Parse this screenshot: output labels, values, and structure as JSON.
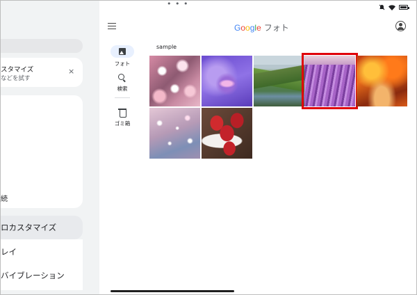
{
  "status_bar": {
    "dots": "• • •"
  },
  "left_panel": {
    "card_title": "スタマイズ",
    "card_subtitle": "などを試す",
    "card_close": "×",
    "item_text": "続",
    "selected_item": "ロカスタマイズ",
    "item_display": "レイ",
    "item_vibration": "バイブレーション"
  },
  "app_bar": {
    "logo": {
      "G": "G",
      "o1": "o",
      "o2": "o",
      "g": "g",
      "l": "l",
      "e": "e",
      "suffix": "フォト"
    }
  },
  "rail": {
    "photos_label": "フォト",
    "search_label": "検索",
    "trash_label": "ゴミ箱"
  },
  "album": {
    "title": "sample",
    "photos": [
      {
        "name": "cherry-blossom",
        "selected": false
      },
      {
        "name": "lotus",
        "selected": false
      },
      {
        "name": "mountain-valley",
        "selected": false
      },
      {
        "name": "lavender-field",
        "selected": true
      },
      {
        "name": "autumn-trees",
        "selected": false
      },
      {
        "name": "sparkles",
        "selected": false
      },
      {
        "name": "strawberries",
        "selected": false
      }
    ]
  },
  "colors": {
    "selection": "#e0000a",
    "accent_pill": "#e8f0fe"
  }
}
